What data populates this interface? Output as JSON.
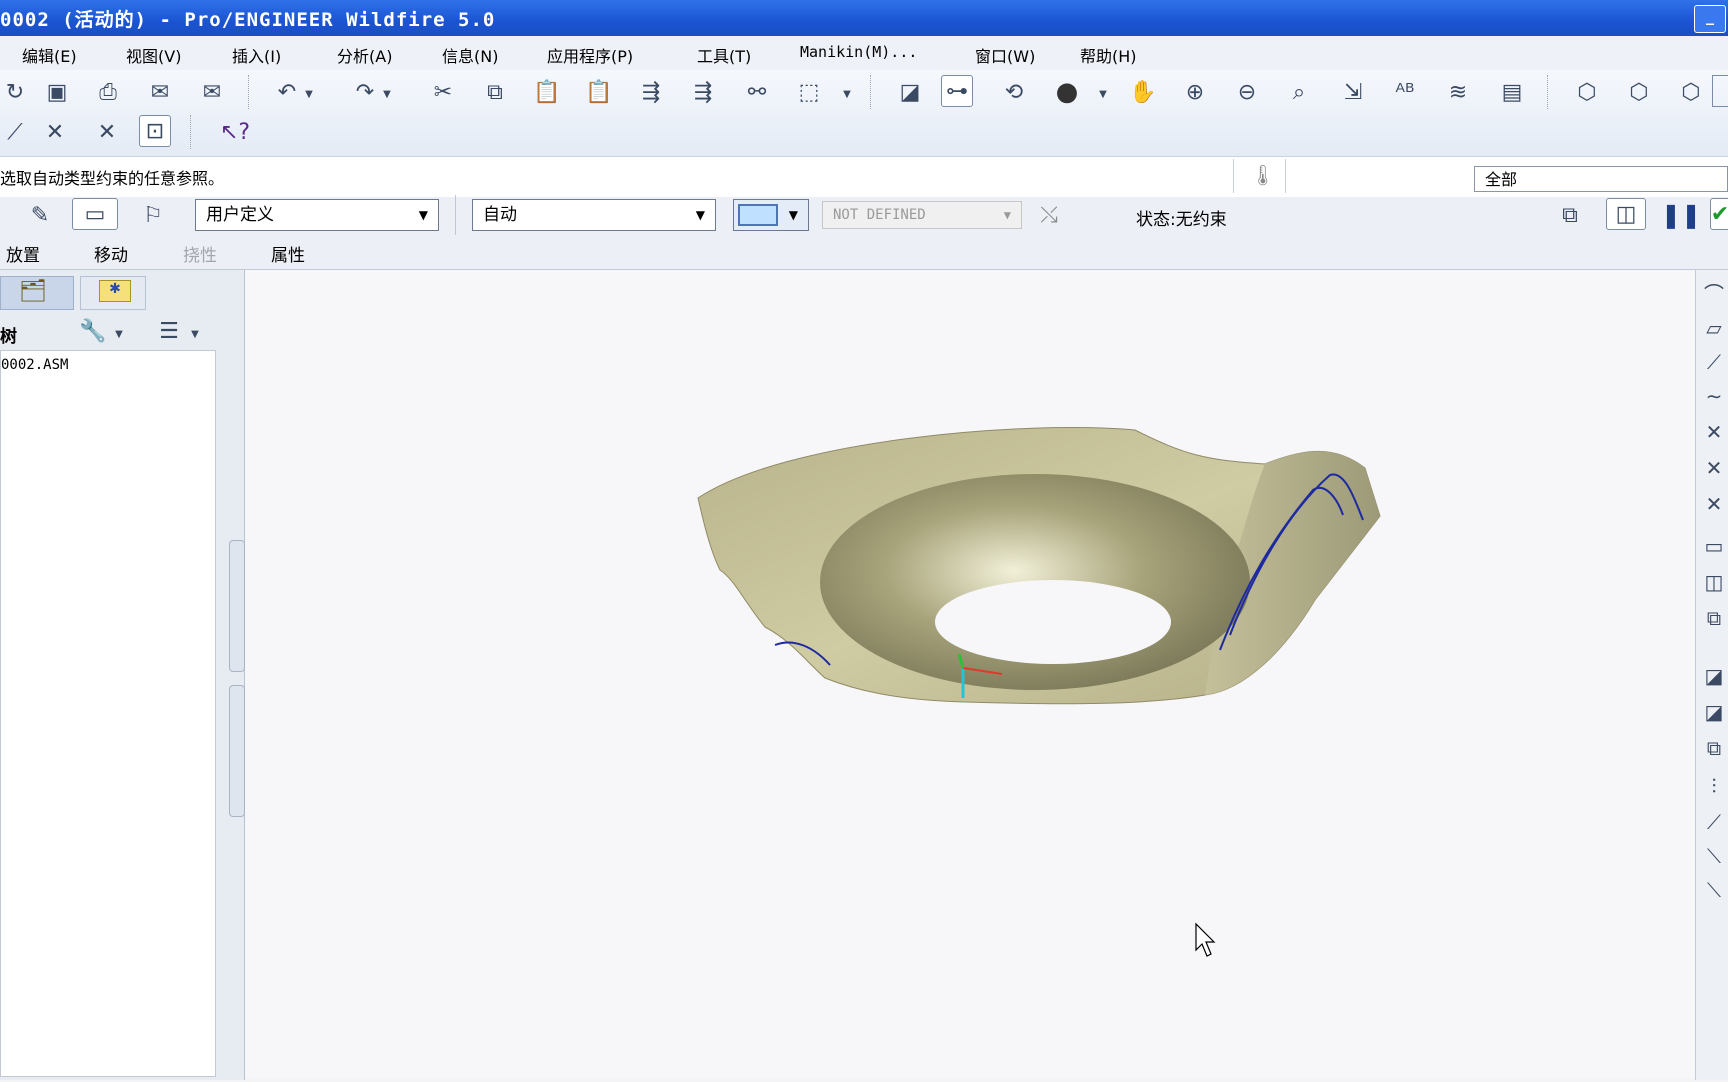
{
  "window": {
    "title": "0002 (活动的) - Pro/ENGINEER Wildfire 5.0",
    "minimize_glyph": "_"
  },
  "menu": [
    "编辑(E)",
    "视图(V)",
    "插入(I)",
    "分析(A)",
    "信息(N)",
    "应用程序(P)",
    "工具(T)",
    "Manikin(M)...",
    "窗口(W)",
    "帮助(H)"
  ],
  "message": "选取自动类型约束的任意参照。",
  "filter": {
    "value": "全部"
  },
  "dashboard": {
    "constraint_set": "用户定义",
    "constraint_type": "自动",
    "offset": "NOT DEFINED",
    "status": "状态:无约束",
    "tabs": [
      "放置",
      "移动",
      "挠性",
      "属性"
    ]
  },
  "model_tree": {
    "title": "树",
    "root": "0002.ASM"
  },
  "colors": {
    "title_bar": "#1b54d1",
    "model": "#c9c59a",
    "edge": "#1e2aa0"
  }
}
